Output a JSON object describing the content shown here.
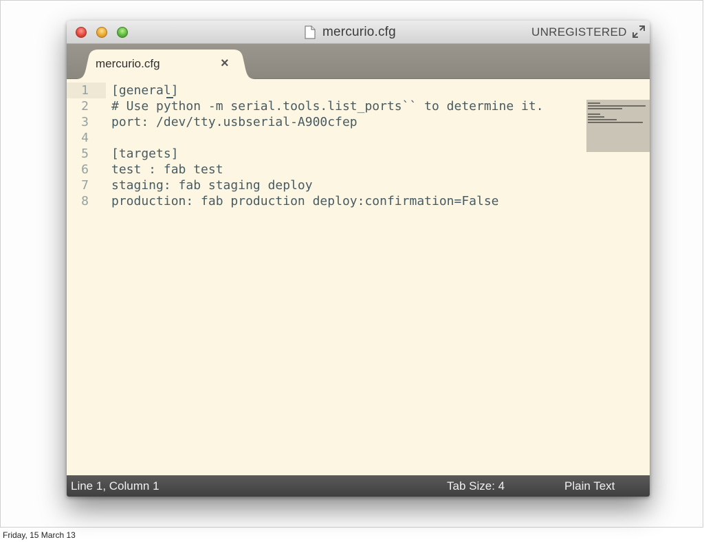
{
  "window": {
    "title": "mercurio.cfg",
    "registration": "UNREGISTERED"
  },
  "tabs": [
    {
      "label": "mercurio.cfg",
      "close": "×"
    }
  ],
  "editor": {
    "lines": [
      {
        "number": "1",
        "text": "[general]"
      },
      {
        "number": "2",
        "text": "# Use python -m serial.tools.list_ports`` to determine it."
      },
      {
        "number": "3",
        "text": "port: /dev/tty.usbserial-A900cfep"
      },
      {
        "number": "4",
        "text": ""
      },
      {
        "number": "5",
        "text": "[targets]"
      },
      {
        "number": "6",
        "text": "test : fab test"
      },
      {
        "number": "7",
        "text": "staging: fab staging deploy"
      },
      {
        "number": "8",
        "text": "production: fab production deploy:confirmation=False"
      }
    ]
  },
  "statusbar": {
    "position": "Line 1, Column 1",
    "tab_size": "Tab Size: 4",
    "syntax": "Plain Text"
  },
  "footer": {
    "date": "Friday, 15 March 13"
  },
  "colors": {
    "editor_bg": "#fdf6e3",
    "code_text": "#475b62",
    "line_number": "#93a1a1",
    "statusbar_bg": "#4a4a4a"
  },
  "icons": [
    "close-button",
    "minimize-button",
    "zoom-button",
    "document-icon",
    "fullscreen-icon",
    "tab-close-icon"
  ]
}
